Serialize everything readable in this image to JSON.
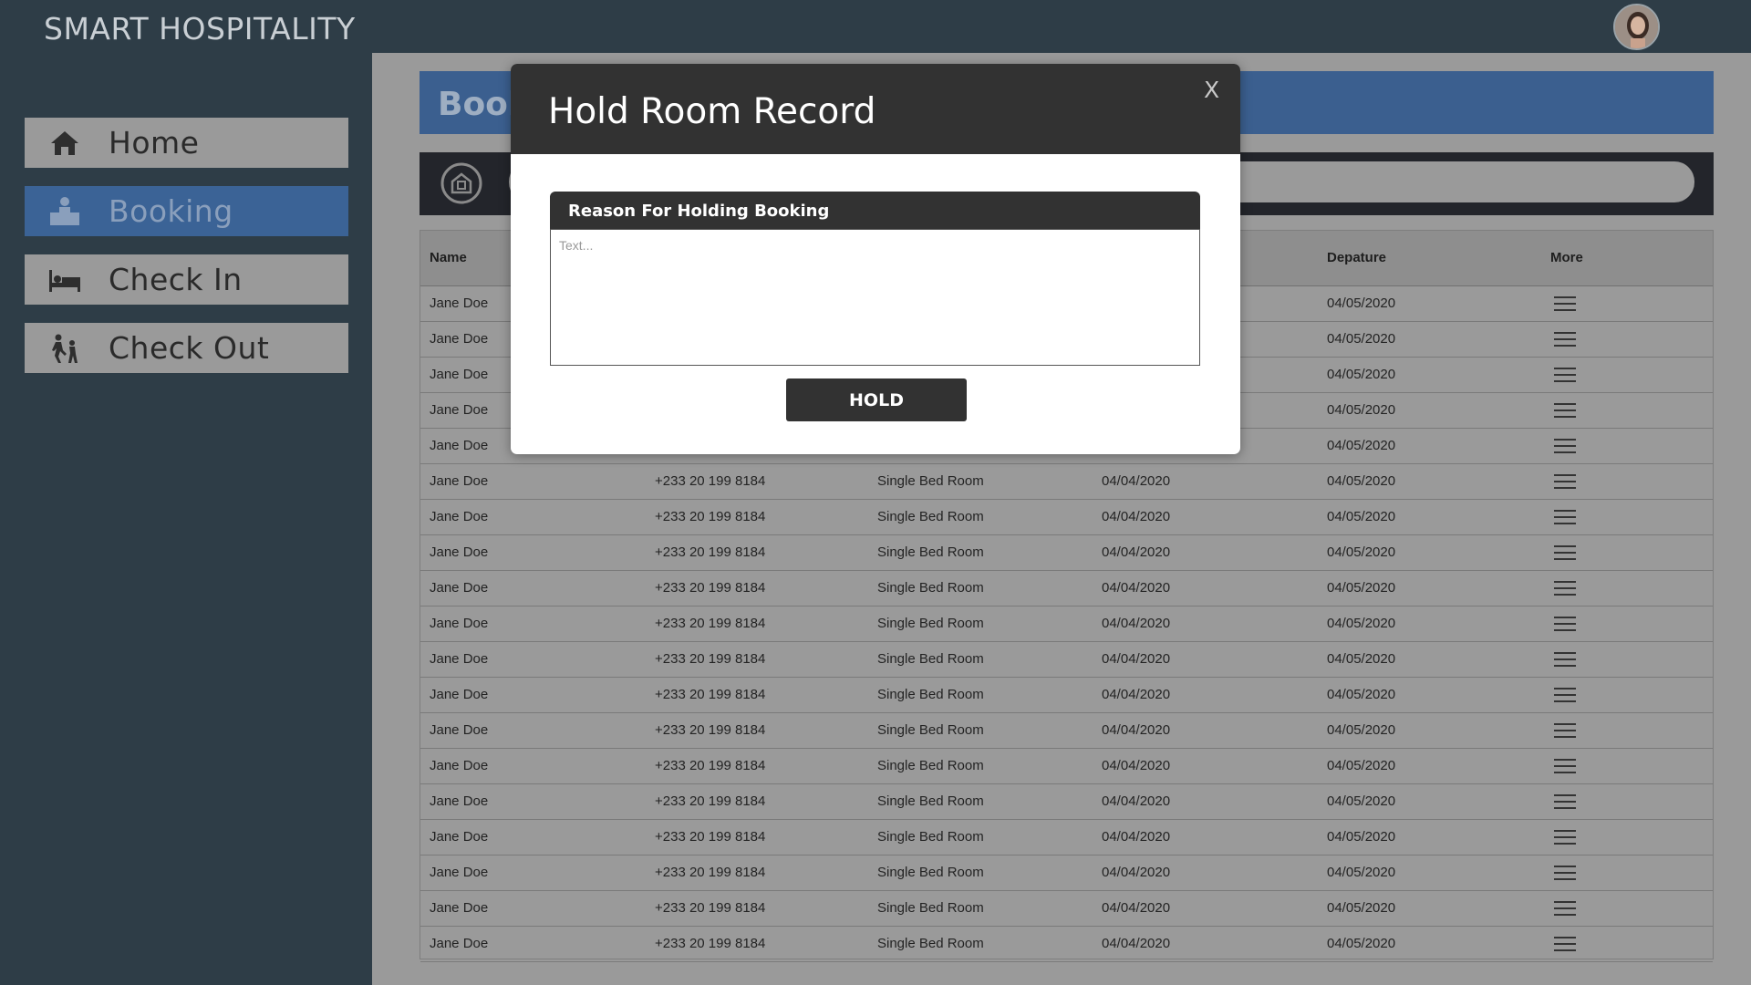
{
  "app": {
    "brand": "SMART HOSPITALITY"
  },
  "sidebar": {
    "items": [
      {
        "label": "Home",
        "icon": "home-icon",
        "active": false
      },
      {
        "label": "Booking",
        "icon": "reception-desk-icon",
        "active": true
      },
      {
        "label": "Check In",
        "icon": "bed-icon",
        "active": false
      },
      {
        "label": "Check Out",
        "icon": "walking-people-icon",
        "active": false
      }
    ]
  },
  "main": {
    "header_title": "Book",
    "search_icon": "hotel-building-icon"
  },
  "table": {
    "headers": [
      "Name",
      "",
      "",
      "",
      "Depature",
      "More"
    ],
    "rows": [
      [
        "Jane Doe",
        "",
        "",
        "",
        "04/05/2020"
      ],
      [
        "Jane Doe",
        "",
        "",
        "",
        "04/05/2020"
      ],
      [
        "Jane Doe",
        "",
        "",
        "",
        "04/05/2020"
      ],
      [
        "Jane Doe",
        "",
        "",
        "",
        "04/05/2020"
      ],
      [
        "Jane Doe",
        "",
        "",
        "",
        "04/05/2020"
      ],
      [
        "Jane Doe",
        "+233 20 199 8184",
        "Single Bed Room",
        "04/04/2020",
        "04/05/2020"
      ],
      [
        "Jane Doe",
        "+233 20 199 8184",
        "Single Bed Room",
        "04/04/2020",
        "04/05/2020"
      ],
      [
        "Jane Doe",
        "+233 20 199 8184",
        "Single Bed Room",
        "04/04/2020",
        "04/05/2020"
      ],
      [
        "Jane Doe",
        "+233 20 199 8184",
        "Single Bed Room",
        "04/04/2020",
        "04/05/2020"
      ],
      [
        "Jane Doe",
        "+233 20 199 8184",
        "Single Bed Room",
        "04/04/2020",
        "04/05/2020"
      ],
      [
        "Jane Doe",
        "+233 20 199 8184",
        "Single Bed Room",
        "04/04/2020",
        "04/05/2020"
      ],
      [
        "Jane Doe",
        "+233 20 199 8184",
        "Single Bed Room",
        "04/04/2020",
        "04/05/2020"
      ],
      [
        "Jane Doe",
        "+233 20 199 8184",
        "Single Bed Room",
        "04/04/2020",
        "04/05/2020"
      ],
      [
        "Jane Doe",
        "+233 20 199 8184",
        "Single Bed Room",
        "04/04/2020",
        "04/05/2020"
      ],
      [
        "Jane Doe",
        "+233 20 199 8184",
        "Single Bed Room",
        "04/04/2020",
        "04/05/2020"
      ],
      [
        "Jane Doe",
        "+233 20 199 8184",
        "Single Bed Room",
        "04/04/2020",
        "04/05/2020"
      ],
      [
        "Jane Doe",
        "+233 20 199 8184",
        "Single Bed Room",
        "04/04/2020",
        "04/05/2020"
      ],
      [
        "Jane Doe",
        "+233 20 199 8184",
        "Single Bed Room",
        "04/04/2020",
        "04/05/2020"
      ],
      [
        "Jane Doe",
        "+233 20 199 8184",
        "Single Bed Room",
        "04/04/2020",
        "04/05/2020"
      ]
    ],
    "more_icon": "hamburger-menu-icon"
  },
  "modal": {
    "title": "Hold Room Record",
    "close_label": "X",
    "reason_label": "Reason For Holding Booking",
    "reason_placeholder": "Text...",
    "reason_value": "",
    "hold_button": "HOLD"
  },
  "colors": {
    "sidebar_bg": "#2e3d47",
    "active_nav": "#3b6396",
    "modal_header": "#323232",
    "overlay_gray": "#9a9a9a"
  }
}
